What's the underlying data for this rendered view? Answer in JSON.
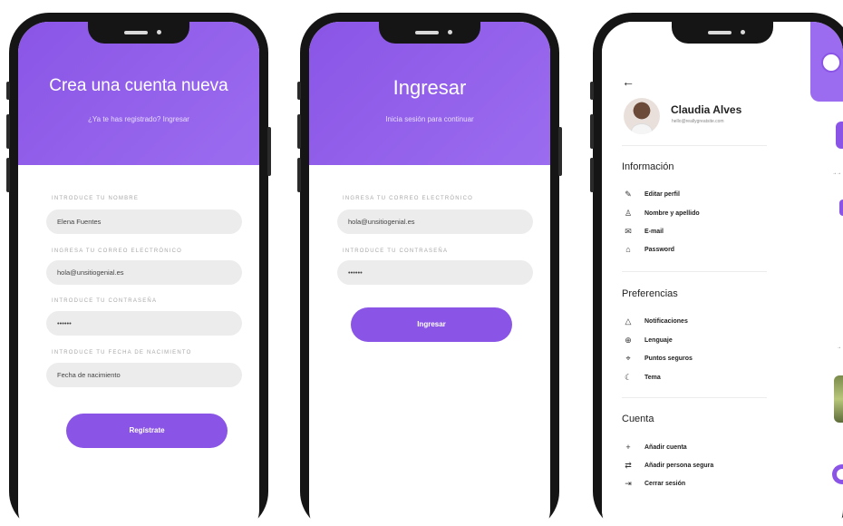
{
  "register": {
    "title": "Crea una cuenta nueva",
    "subtitle": "¿Ya te has registrado? Ingresar",
    "fields": [
      {
        "label": "INTRODUCE TU NOMBRE",
        "value": "Elena Fuentes"
      },
      {
        "label": "INGRESA TU CORREO ELECTRÓNICO",
        "value": "hola@unsitiogenial.es"
      },
      {
        "label": "INTRODUCE TU CONTRASEÑA",
        "value": "••••••"
      },
      {
        "label": "INTRODUCE TU FECHA DE NACIMIENTO",
        "value": "Fecha de nacimiento"
      }
    ],
    "button": "Regístrate"
  },
  "login": {
    "title": "Ingresar",
    "subtitle": "Inicia sesión para continuar",
    "fields": [
      {
        "label": "INGRESA TU CORREO ELECTRÓNICO",
        "value": "hola@unsitiogenial.es"
      },
      {
        "label": "INTRODUCE TU CONTRASEÑA",
        "value": "••••••"
      }
    ],
    "button": "Ingresar"
  },
  "menu": {
    "back_icon": "arrow-left-icon",
    "profile": {
      "name": "Claudia Alves",
      "email": "hello@reallygreatsite.com"
    },
    "sections": [
      {
        "title": "Información",
        "items": [
          {
            "label": "Editar perfil",
            "icon": "edit-icon"
          },
          {
            "label": "Nombre y apellido",
            "icon": "user-icon"
          },
          {
            "label": "E-mail",
            "icon": "mail-icon"
          },
          {
            "label": "Password",
            "icon": "lock-icon"
          }
        ]
      },
      {
        "title": "Preferencias",
        "items": [
          {
            "label": "Notificaciones",
            "icon": "bell-icon"
          },
          {
            "label": "Lenguaje",
            "icon": "globe-icon"
          },
          {
            "label": "Puntos seguros",
            "icon": "pin-icon"
          },
          {
            "label": "Tema",
            "icon": "moon-icon"
          }
        ]
      },
      {
        "title": "Cuenta",
        "items": [
          {
            "label": "Añadir cuenta",
            "icon": "plus-icon"
          },
          {
            "label": "Añadir persona segura",
            "icon": "swap-icon"
          },
          {
            "label": "Cerrar sesión",
            "icon": "logout-icon"
          }
        ]
      }
    ]
  },
  "colors": {
    "accent": "#8a55e6",
    "field_bg": "#ececec"
  }
}
